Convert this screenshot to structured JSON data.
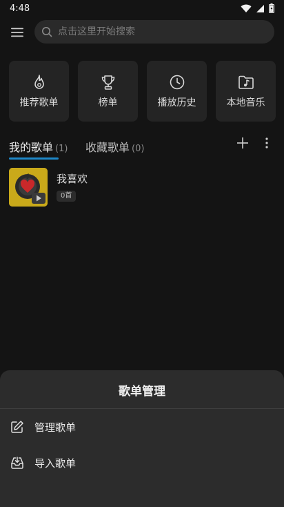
{
  "status_bar": {
    "time": "4:48"
  },
  "search": {
    "placeholder": "点击这里开始搜索"
  },
  "quick_tiles": [
    {
      "label": "推荐歌单",
      "icon": "flame-icon"
    },
    {
      "label": "榜单",
      "icon": "trophy-icon"
    },
    {
      "label": "播放历史",
      "icon": "clock-icon"
    },
    {
      "label": "本地音乐",
      "icon": "music-folder-icon"
    }
  ],
  "tabs": [
    {
      "label": "我的歌单",
      "count": "(1)"
    },
    {
      "label": "收藏歌单",
      "count": "(0)"
    }
  ],
  "playlists": [
    {
      "title": "我喜欢",
      "count": "0首"
    }
  ],
  "sheet": {
    "title": "歌单管理",
    "items": [
      {
        "label": "管理歌单",
        "icon": "edit-icon"
      },
      {
        "label": "导入歌单",
        "icon": "import-icon"
      }
    ]
  },
  "colors": {
    "background": "#141414",
    "tile": "#242424",
    "accent": "#1e88c9",
    "sheet": "#2c2c2c",
    "cover": "#c9a91a"
  }
}
